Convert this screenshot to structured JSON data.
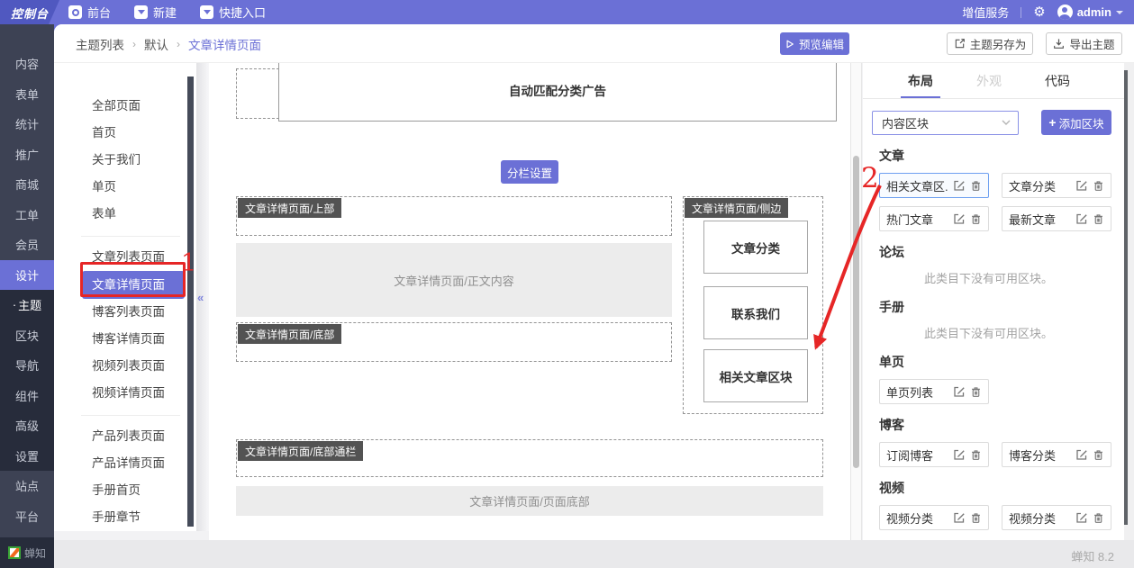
{
  "colors": {
    "accent": "#6b70d6",
    "annotation": "#e62626",
    "sidebar_bg": "#3d4254",
    "sidebar_group_bg": "#272c3b"
  },
  "topbar": {
    "logo": "控制台",
    "frontend": "前台",
    "create": "新建",
    "quick_entry": "快捷入口",
    "value_added": "增值服务",
    "username": "admin"
  },
  "sidebar": {
    "items": [
      "内容",
      "表单",
      "统计",
      "推广",
      "商城",
      "工单",
      "会员",
      "设计",
      "主题",
      "区块",
      "导航",
      "组件",
      "高级",
      "设置",
      "站点",
      "平台"
    ],
    "active_item": "设计",
    "active_sub_item": "主题",
    "bullet": "·",
    "brand": "蝉知"
  },
  "breadcrumb": {
    "items": [
      "主题列表",
      "默认",
      "文章详情页面"
    ],
    "separator": "›"
  },
  "header_actions": {
    "preview": "预览编辑",
    "save_as": "主题另存为",
    "export": "导出主题"
  },
  "page_list": {
    "group1": [
      "全部页面",
      "首页",
      "关于我们",
      "单页",
      "表单"
    ],
    "group2": [
      "文章列表页面",
      "文章详情页面",
      "博客列表页面",
      "博客详情页面",
      "视频列表页面",
      "视频详情页面"
    ],
    "group3": [
      "产品列表页面",
      "产品详情页面",
      "手册首页",
      "手册章节"
    ],
    "active": "文章详情页面",
    "collapse": "«"
  },
  "canvas": {
    "ad_block": "自动匹配分类广告",
    "column_settings": "分栏设置",
    "top_region": "文章详情页面/上部",
    "content_region": "文章详情页面/正文内容",
    "bottom_region": "文章详情页面/底部",
    "side_region": "文章详情页面/侧边",
    "side_blocks": [
      "文章分类",
      "联系我们",
      "相关文章区块"
    ],
    "bottom_bar_region": "文章详情页面/底部通栏",
    "page_footer_region": "文章详情页面/页面底部"
  },
  "panel": {
    "tabs": [
      "布局",
      "外观",
      "代码"
    ],
    "active_tab": "布局",
    "block_category": "内容区块",
    "plus": "+",
    "add_block": "添加区块",
    "sections": [
      {
        "title": "文章",
        "chips": [
          "相关文章区...",
          "文章分类",
          "热门文章",
          "最新文章"
        ]
      },
      {
        "title": "论坛",
        "empty": "此类目下没有可用区块。"
      },
      {
        "title": "手册",
        "empty": "此类目下没有可用区块。"
      },
      {
        "title": "单页",
        "chips": [
          "单页列表"
        ]
      },
      {
        "title": "博客",
        "chips": [
          "订阅博客",
          "博客分类"
        ]
      },
      {
        "title": "视频",
        "chips": [
          "视频分类",
          "视频分类"
        ]
      }
    ]
  },
  "annotations": {
    "step1": "1",
    "step2": "2"
  },
  "footer": {
    "version": "蝉知 8.2"
  }
}
